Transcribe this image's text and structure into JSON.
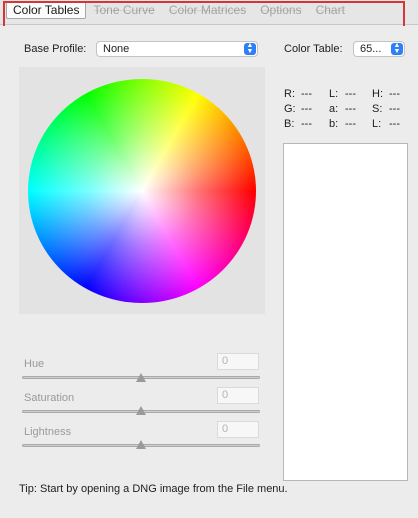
{
  "tabs": [
    {
      "label": "Color Tables"
    },
    {
      "label": "Tone Curve"
    },
    {
      "label": "Color Matrices"
    },
    {
      "label": "Options"
    },
    {
      "label": "Chart"
    }
  ],
  "base_profile": {
    "label": "Base Profile:",
    "value": "None"
  },
  "color_table": {
    "label": "Color Table:",
    "value": "65..."
  },
  "readout": {
    "r_label": "R:",
    "r": "---",
    "l1_label": "L:",
    "l1": "---",
    "h_label": "H:",
    "h": "---",
    "g_label": "G:",
    "g": "---",
    "a_label": "a:",
    "a": "---",
    "s_label": "S:",
    "s": "---",
    "b_label": "B:",
    "b": "---",
    "b2_label": "b:",
    "b2": "---",
    "l2_label": "L:",
    "l2": "---"
  },
  "sliders": {
    "hue": {
      "label": "Hue",
      "value": "0",
      "position": 0.5
    },
    "saturation": {
      "label": "Saturation",
      "value": "0",
      "position": 0.5
    },
    "lightness": {
      "label": "Lightness",
      "value": "0",
      "position": 0.5
    }
  },
  "tip": "Tip: Start by opening a DNG image from the File menu.",
  "colors": {
    "accent": "#2f7ff7",
    "highlight_border": "#d63538"
  }
}
